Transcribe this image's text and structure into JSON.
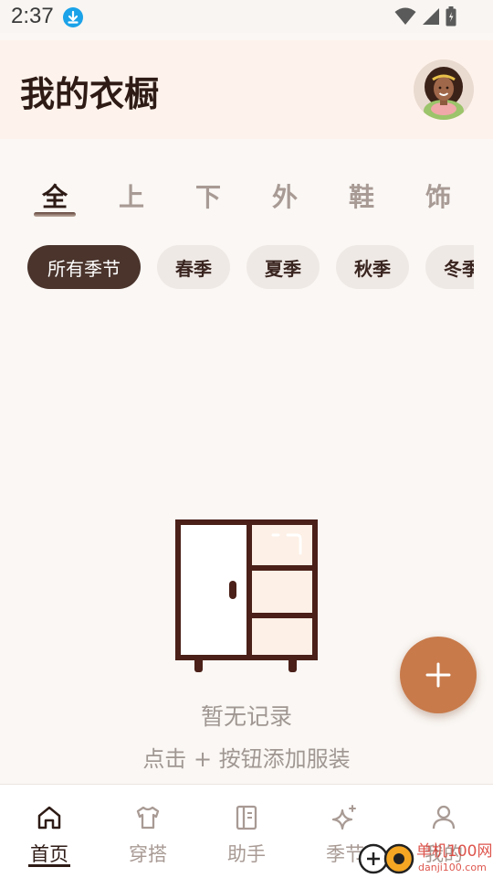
{
  "status_bar": {
    "time": "2:37"
  },
  "header": {
    "title": "我的衣橱"
  },
  "category_tabs": [
    {
      "label": "全",
      "active": true
    },
    {
      "label": "上",
      "active": false
    },
    {
      "label": "下",
      "active": false
    },
    {
      "label": "外",
      "active": false
    },
    {
      "label": "鞋",
      "active": false
    },
    {
      "label": "饰",
      "active": false
    }
  ],
  "season_chips": [
    {
      "label": "所有季节",
      "active": true
    },
    {
      "label": "春季",
      "active": false
    },
    {
      "label": "夏季",
      "active": false
    },
    {
      "label": "秋季",
      "active": false
    },
    {
      "label": "冬季",
      "active": false
    }
  ],
  "empty_state": {
    "title": "暂无记录",
    "subtitle": "点击 + 按钮添加服装"
  },
  "fab": {
    "icon": "plus-icon"
  },
  "bottom_nav": [
    {
      "label": "首页",
      "icon": "home-icon",
      "active": true
    },
    {
      "label": "穿搭",
      "icon": "shirt-icon",
      "active": false
    },
    {
      "label": "助手",
      "icon": "book-icon",
      "active": false
    },
    {
      "label": "季节",
      "icon": "sparkle-icon",
      "active": false
    },
    {
      "label": "我的",
      "icon": "person-icon",
      "active": false
    }
  ],
  "colors": {
    "accent": "#c87a4a",
    "primary_dark": "#4a342c",
    "header_bg": "#fef3ec",
    "background": "#faf7f4"
  }
}
